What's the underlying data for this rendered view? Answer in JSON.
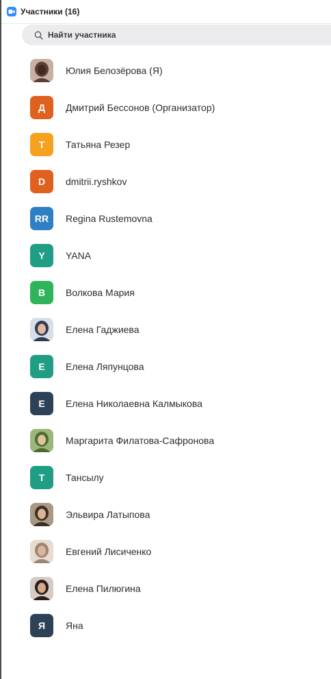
{
  "header": {
    "title": "Участники (16)"
  },
  "search": {
    "placeholder": "Найти участника"
  },
  "participants": [
    {
      "name": "Юлия Белозёрова (Я)",
      "avatar_type": "photo",
      "initials": "",
      "color": "#8a6f68",
      "photo_colors": [
        "#c8b0a5",
        "#5c3e33",
        "#3d2a25"
      ]
    },
    {
      "name": "Дмитрий Бессонов (Организатор)",
      "avatar_type": "initials",
      "initials": "Д",
      "color": "#e0611f"
    },
    {
      "name": "Татьяна Резер",
      "avatar_type": "initials",
      "initials": "T",
      "color": "#f5a21e"
    },
    {
      "name": "dmitrii.ryshkov",
      "avatar_type": "initials",
      "initials": "D",
      "color": "#e0611f"
    },
    {
      "name": "Regina Rustemovna",
      "avatar_type": "initials",
      "initials": "RR",
      "color": "#2e7fc4"
    },
    {
      "name": "YANA",
      "avatar_type": "initials",
      "initials": "Y",
      "color": "#1f9e85"
    },
    {
      "name": "Волкова Мария",
      "avatar_type": "initials",
      "initials": "B",
      "color": "#2fb45a"
    },
    {
      "name": "Елена Гаджиева",
      "avatar_type": "photo",
      "initials": "",
      "color": "#5b7a99",
      "photo_colors": [
        "#d8dee6",
        "#2a3d55",
        "#e3b79b"
      ]
    },
    {
      "name": "Елена Ляпунцова",
      "avatar_type": "initials",
      "initials": "E",
      "color": "#1f9e85"
    },
    {
      "name": "Елена Николаевна  Калмыкова",
      "avatar_type": "initials",
      "initials": "E",
      "color": "#2e4257"
    },
    {
      "name": "Маргарита Филатова-Сафронова",
      "avatar_type": "photo",
      "initials": "",
      "color": "#6a8a4a",
      "photo_colors": [
        "#9cb77b",
        "#4f6b2e",
        "#e2c1a3"
      ]
    },
    {
      "name": "Тансылу",
      "avatar_type": "initials",
      "initials": "T",
      "color": "#1f9e85"
    },
    {
      "name": "Эльвира Латыпова",
      "avatar_type": "photo",
      "initials": "",
      "color": "#6b5a4a",
      "photo_colors": [
        "#a99886",
        "#3e2f24",
        "#dcb49a"
      ]
    },
    {
      "name": "Евгений Лисиченко",
      "avatar_type": "photo",
      "initials": "",
      "color": "#b8a190",
      "photo_colors": [
        "#e6dcd2",
        "#9c8574",
        "#d9b59c"
      ]
    },
    {
      "name": "Елена Пилюгина",
      "avatar_type": "photo",
      "initials": "",
      "color": "#4a3a34",
      "photo_colors": [
        "#d6ccc6",
        "#2b1e1a",
        "#d5a98d"
      ]
    },
    {
      "name": "Яна",
      "avatar_type": "initials",
      "initials": "Я",
      "color": "#2e4257"
    }
  ]
}
